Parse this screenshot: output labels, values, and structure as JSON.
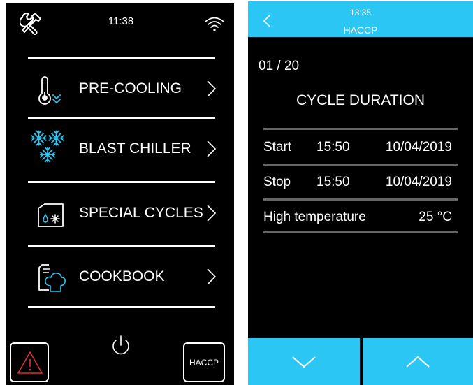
{
  "left_panel": {
    "time": "11:38",
    "menu": [
      {
        "label": "PRE-COOLING",
        "icon": "thermometer-down-icon"
      },
      {
        "label": "BLAST CHILLER",
        "icon": "snowflakes-icon"
      },
      {
        "label": "SPECIAL CYCLES",
        "icon": "folder-snowflake-icon"
      },
      {
        "label": "COOKBOOK",
        "icon": "chef-hat-book-icon"
      }
    ],
    "haccp_button": "HACCP"
  },
  "right_panel": {
    "time": "13:35",
    "title": "HACCP",
    "counter": "01 / 20",
    "section_title": "CYCLE DURATION",
    "rows": [
      {
        "label": "Start",
        "time": "15:50",
        "date": "10/04/2019"
      },
      {
        "label": "Stop",
        "time": "15:50",
        "date": "10/04/2019"
      }
    ],
    "high_temp": {
      "label": "High temperature",
      "value": "25 °C"
    }
  },
  "colors": {
    "accent": "#2bc6f4",
    "background": "#000000",
    "alarm": "#e03030",
    "text": "#ffffff"
  }
}
